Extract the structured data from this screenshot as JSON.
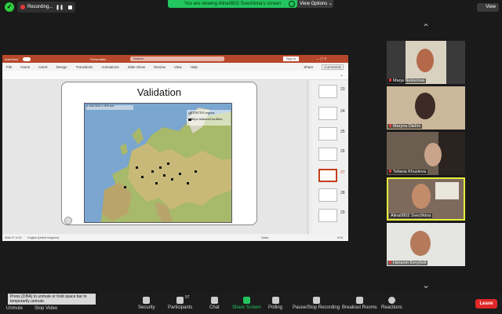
{
  "topbar": {
    "recording_label": "Recording...",
    "viewing_banner": "You are viewing Alina0802 Svechkina's screen",
    "view_options": "View Options",
    "view_button": "View"
  },
  "ppt": {
    "title_left": "AutoSave",
    "filename": "Presentatio...",
    "search_placeholder": "Search",
    "signin": "Sign in",
    "tabs": [
      "File",
      "Home",
      "Insert",
      "Design",
      "Transitions",
      "Animations",
      "Slide Show",
      "Review",
      "View",
      "Help"
    ],
    "share": "Share",
    "comments": "Comments",
    "slide_title": "Validation",
    "map_legend_1": "EUNUTS3 regions",
    "map_legend_2": "Major industrial facilities",
    "map_scale": "0    250    500          1 000 km",
    "thumb_numbers": [
      "23",
      "24",
      "25",
      "26",
      "27",
      "28",
      "29"
    ],
    "status_slide": "Slide 27 of 29",
    "status_lang": "English (United Kingdom)",
    "status_notes": "Notes",
    "status_zoom": "61%"
  },
  "participants": [
    {
      "name": "Marja Nesterova",
      "muted": true
    },
    {
      "name": "Maryna Dielini",
      "muted": true
    },
    {
      "name": "Tetiana Khuzieva",
      "muted": true
    },
    {
      "name": "Alina0802 Svechkina",
      "muted": false
    },
    {
      "name": "Наталія Кочубей",
      "muted": true
    }
  ],
  "toolbar": {
    "tooltip": "Press {0:BA} to unmute or hold space bar to temporarily unmute.",
    "unmute": "Unmute",
    "stop_video": "Stop Video",
    "security": "Security",
    "participants": "Participants",
    "participant_count": "97",
    "chat": "Chat",
    "share_screen": "Share Screen",
    "polling": "Polling",
    "pause_stop": "Pause/Stop Recording",
    "breakout": "Breakout Rooms",
    "reactions": "Reactions",
    "leave": "Leave"
  },
  "colors": {
    "accent_green": "#22c55e",
    "ppt_red": "#b7472a",
    "leave_red": "#e02828"
  }
}
